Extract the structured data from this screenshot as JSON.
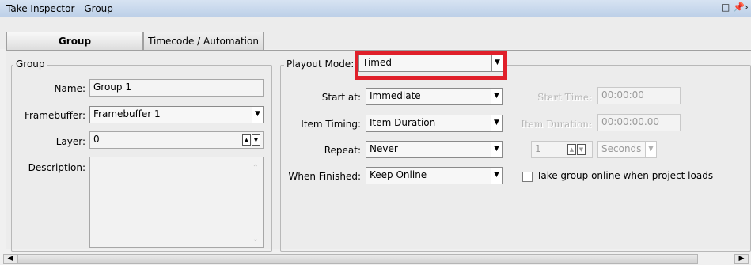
{
  "window": {
    "title": "Take Inspector - Group",
    "controls": [
      "□",
      "📌",
      "›"
    ]
  },
  "tabs": [
    {
      "label": "Group",
      "active": true
    },
    {
      "label": "Timecode / Automation",
      "active": false
    }
  ],
  "group": {
    "legend": "Group",
    "name_label": "Name:",
    "name_value": "Group 1",
    "framebuffer_label": "Framebuffer:",
    "framebuffer_value": "Framebuffer 1",
    "layer_label": "Layer:",
    "layer_value": "0",
    "description_label": "Description:"
  },
  "playout": {
    "mode_label": "Playout Mode:",
    "mode_value": "Timed",
    "start_at_label": "Start at:",
    "start_at_value": "Immediate",
    "item_timing_label": "Item Timing:",
    "item_timing_value": "Item Duration",
    "repeat_label": "Repeat:",
    "repeat_value": "Never",
    "when_finished_label": "When Finished:",
    "when_finished_value": "Keep Online",
    "start_time_label": "Start Time:",
    "start_time_value": "00:00:00",
    "item_duration_label": "Item Duration:",
    "item_duration_value": "00:00:00.00",
    "repeat_count_value": "1",
    "repeat_unit_value": "Seconds",
    "take_online_label": "Take group online when project loads",
    "take_online_checked": false
  },
  "colors": {
    "highlight": "#e0202a",
    "titlebar": "#c7d8ee"
  }
}
